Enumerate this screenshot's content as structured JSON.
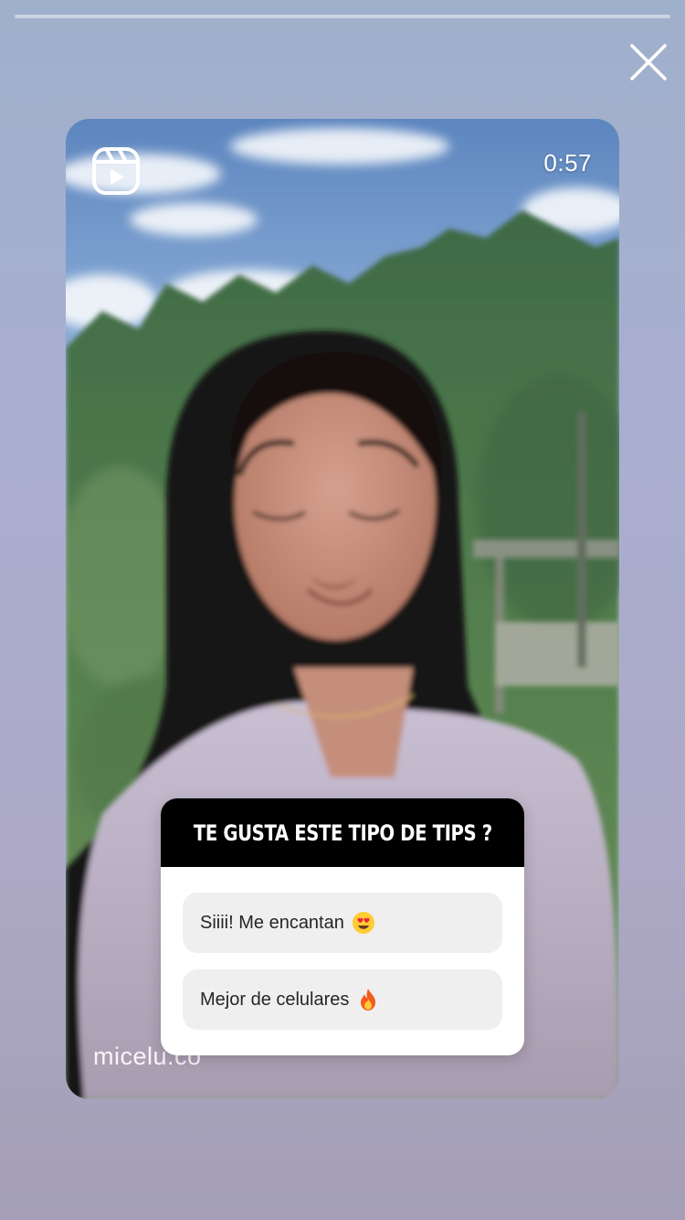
{
  "story": {
    "progress": 0.0
  },
  "reel": {
    "duration": "0:57",
    "watermark": "micelu.co",
    "icon": "reels-icon"
  },
  "poll": {
    "question": "TE GUSTA ESTE TIPO DE TIPS ?",
    "options": [
      {
        "label": "Siiii! Me encantan",
        "emoji": "heart-eyes-emoji"
      },
      {
        "label": "Mejor de celulares",
        "emoji": "fire-emoji"
      }
    ]
  },
  "icons": {
    "close": "close-icon"
  },
  "colors": {
    "poll_header_bg": "#000000",
    "poll_option_bg": "#efefef",
    "text_white": "#ffffff"
  }
}
